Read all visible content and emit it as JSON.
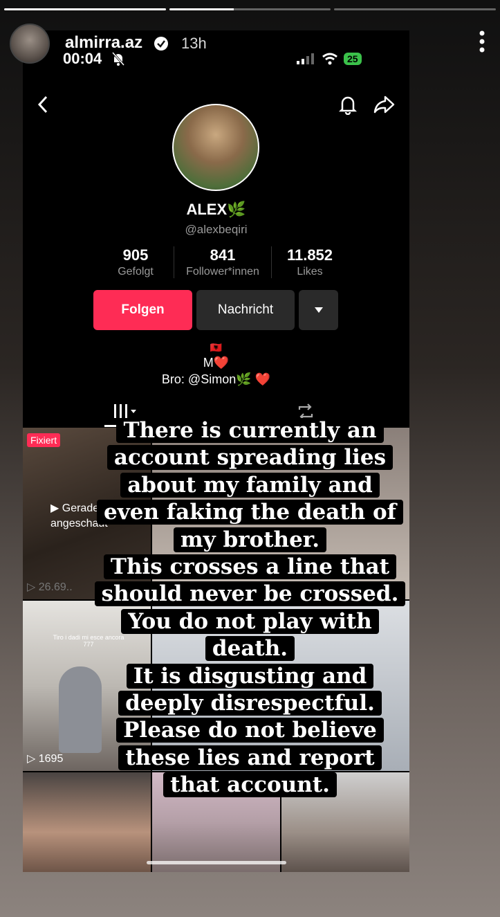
{
  "story": {
    "username": "almirra.az",
    "time_ago": "13h",
    "progress": [
      1.0,
      0.4,
      0.0
    ]
  },
  "screenshot": {
    "status_bar": {
      "clock": "00:04",
      "battery": "25"
    },
    "profile": {
      "name": "ALEX",
      "name_emoji": "🌿",
      "handle": "@alexbeqiri",
      "stats": [
        {
          "value": "905",
          "label": "Gefolgt"
        },
        {
          "value": "841",
          "label": "Follower*innen"
        },
        {
          "value": "11.852",
          "label": "Likes"
        }
      ],
      "buttons": {
        "follow": "Folgen",
        "message": "Nachricht"
      },
      "bio": {
        "flag": "🇦🇱",
        "line1": "M❤️",
        "line2": "Bro: @Simon🌿 ❤️"
      }
    },
    "grid": {
      "pinned_label": "Fixiert",
      "watched_label_1": "▶ Gerade",
      "watched_label_2": "angeschaut",
      "tile1_views": "▷ 26.69..",
      "tile2_views": "▷ 1695",
      "tile2_caption": "Tiro i dadi mi esce ancora 777"
    }
  },
  "overlay_text": [
    "There is currently an",
    "account spreading lies",
    "about my family and",
    "even faking the death of",
    "my brother.",
    "This crosses a line that",
    "should never be crossed.",
    "You do not play with",
    "death.",
    "It is disgusting and",
    "deeply disrespectful.",
    "Please do not believe",
    "these lies and report",
    "that account."
  ],
  "colors": {
    "follow": "#fe2c55",
    "verified": "#ffffff",
    "battery": "#3bc14a"
  }
}
